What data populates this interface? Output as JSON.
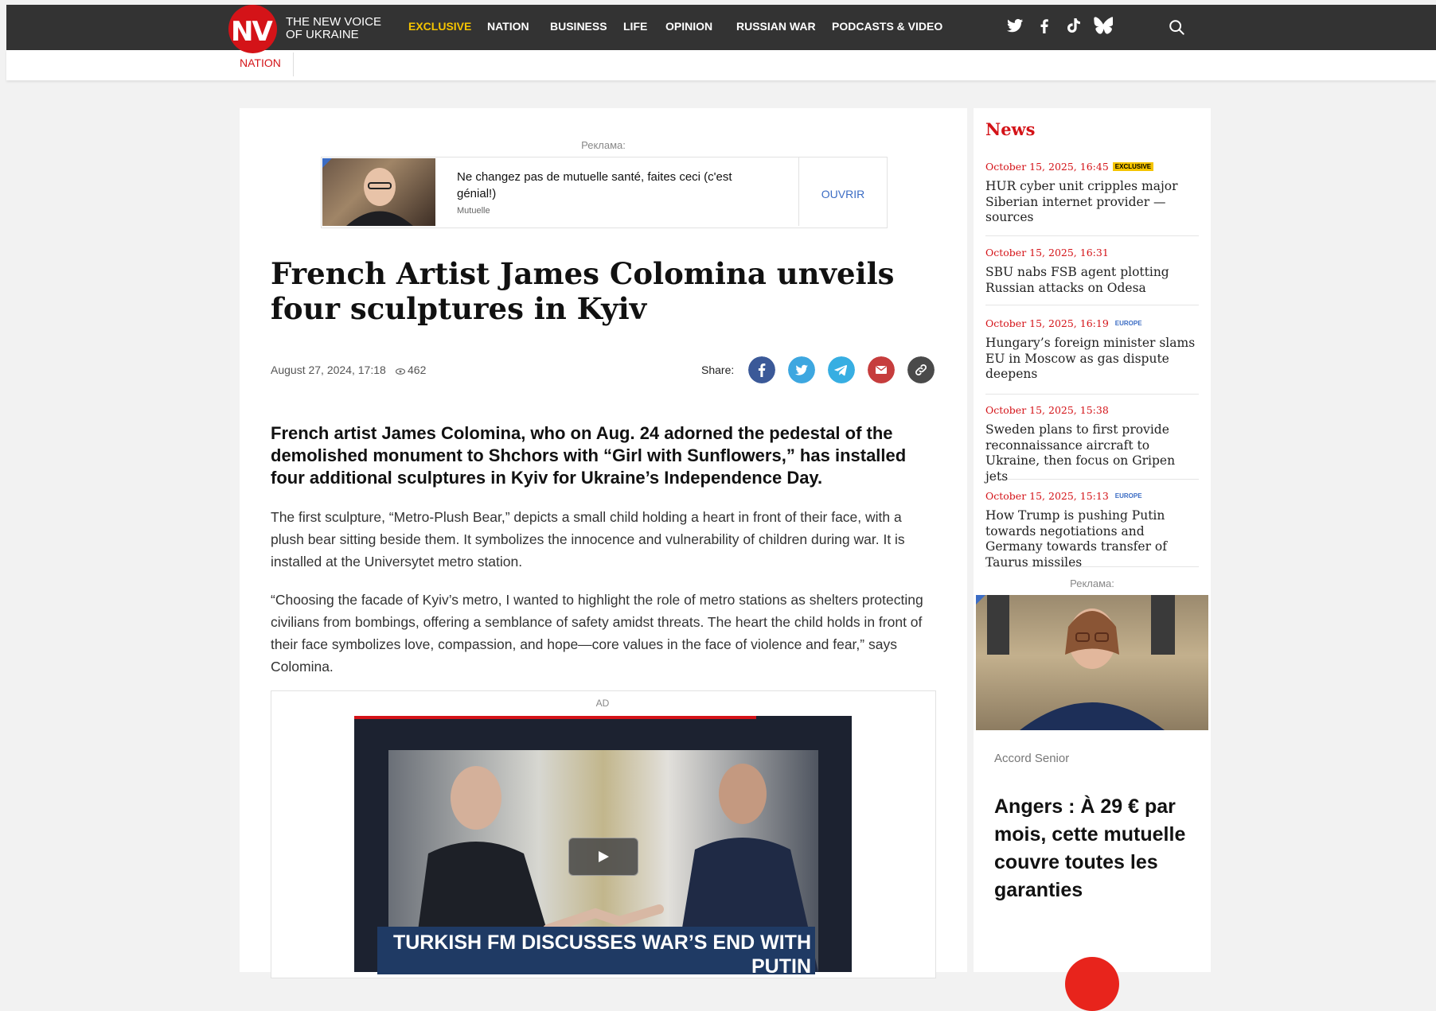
{
  "header": {
    "logo_mark": "NV",
    "logo_text": "THE NEW VOICE OF UKRAINE",
    "nav": [
      "EXCLUSIVE",
      "NATION",
      "BUSINESS",
      "LIFE",
      "OPINION",
      "RUSSIAN WAR",
      "PODCASTS & VIDEO"
    ],
    "active_nav": "EXCLUSIVE",
    "social_icons": [
      "twitter-icon",
      "facebook-icon",
      "tiktok-icon",
      "bluesky-icon"
    ],
    "accent_color": "#d41318",
    "exclusive_color": "#f5c400"
  },
  "subnav": {
    "section": "NATION"
  },
  "top_ad": {
    "label": "Реклама:",
    "title": "Ne changez pas de mutuelle santé, faites ceci (c'est génial!)",
    "source": "Mutuelle",
    "cta": "OUVRIR"
  },
  "article": {
    "headline": "French Artist James Colomina unveils four sculptures in Kyiv",
    "date": "August 27, 2024, 17:18",
    "views": "462",
    "share_label": "Share:",
    "share_buttons": [
      "facebook",
      "twitter",
      "telegram",
      "email",
      "copy-link"
    ],
    "lead": "French artist James Colomina, who on Aug. 24 adorned the pedestal of the demolished monument to Shchors with “Girl with Sunflowers,” has installed four additional sculptures in Kyiv for Ukraine’s Independence Day.",
    "paragraphs": [
      "The first sculpture, “Metro-Plush Bear,” depicts a small child holding a heart in front of their face, with a plush bear sitting beside them. It symbolizes the innocence and vulnerability of children during war. It is installed at the Universytet metro station.",
      "“Choosing the facade of Kyiv’s metro, I wanted to highlight the role of metro stations as shelters protecting civilians from bombings, offering a semblance of safety amidst threats. The heart the child holds in front of their face symbolizes love, compassion, and hope—core values in the face of violence and fear,” says Colomina."
    ]
  },
  "video_ad": {
    "label": "AD",
    "caption": "TURKISH FM DISCUSSES WAR’S END WITH PUTIN"
  },
  "sidebar": {
    "title": "News",
    "items": [
      {
        "time": "October 15, 2025, 16:45",
        "tag": "EXCLUSIVE",
        "headline": "HUR cyber unit cripples major Siberian internet provider — sources"
      },
      {
        "time": "October 15, 2025, 16:31",
        "tag": "",
        "headline": "SBU nabs FSB agent plotting Russian attacks on Odesa"
      },
      {
        "time": "October 15, 2025, 16:19",
        "tag": "EUROPE",
        "headline": "Hungary’s foreign minister slams EU in Moscow as gas dispute deepens"
      },
      {
        "time": "October 15, 2025, 15:38",
        "tag": "",
        "headline": "Sweden plans to first provide reconnaissance aircraft to Ukraine, then focus on Gripen jets"
      },
      {
        "time": "October 15, 2025, 15:13",
        "tag": "EUROPE",
        "headline": "How Trump is pushing Putin towards negotiations and Germany towards transfer of Taurus missiles"
      }
    ],
    "ad": {
      "label": "Реклама:",
      "source": "Accord Senior",
      "title": "Angers : À 29 € par mois, cette mutuelle couvre toutes les garanties"
    }
  }
}
